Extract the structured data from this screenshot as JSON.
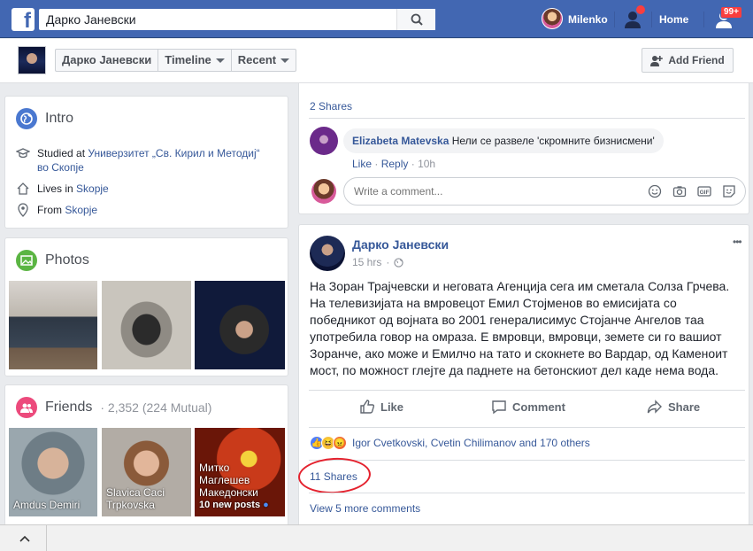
{
  "topbar": {
    "search_value": "Дарко Јаневски",
    "user_name": "Milenko",
    "home_label": "Home",
    "notifications_badge": "99+",
    "brand_color": "#4267b2"
  },
  "subbar": {
    "tabs": [
      "Дарко Јаневски",
      "Timeline",
      "Recent"
    ],
    "add_friend_label": "Add Friend"
  },
  "intro": {
    "title": "Intro",
    "studied_prefix": "Studied at",
    "studied_link": "Универзитет „Св. Кирил и Методиј“",
    "studied_link_2": "во Скопје",
    "lives_prefix": "Lives in",
    "lives_link": "Skopje",
    "from_prefix": "From",
    "from_link": "Skopje"
  },
  "photos": {
    "title": "Photos"
  },
  "friends": {
    "title": "Friends",
    "count": "· 2,352 (224 Mutual)",
    "tiles": [
      {
        "name": "Amdus Demiri",
        "sub": ""
      },
      {
        "name": "Slavica Caci",
        "sub": "Trpkovska"
      },
      {
        "name": "Митко",
        "sub": "Маглешев",
        "sub2": "Македонски",
        "extra": "10 new posts"
      }
    ]
  },
  "prev_post": {
    "shares": "2 Shares",
    "comment_author": "Elizabeta Matevska",
    "comment_text": "Нели се развеле 'скромните бизнисмени'",
    "like": "Like",
    "reply": "Reply",
    "time": "10h",
    "write_placeholder": "Write a comment..."
  },
  "post": {
    "author": "Дарко Јаневски",
    "time": "15 hrs",
    "body": "На Зоран Трајчевски и неговата Агенција сега им сметала Солза Грчева. На телевизијата на вмровецот Емил Стојменов во емисијата со победникот од војната во 2001 генералисимус Стојанче Ангелов таа употребила говор на омраза. Е вмровци, вмровци, земете си го вашиот Зоранче, ако може и Емилчо на тато и скокнете во Вардар, од Каменоит мост, по можност глејте да паднете на бетонскиот дел каде нема вода.",
    "like_label": "Like",
    "comment_label": "Comment",
    "share_label": "Share",
    "reactions_text": "Igor Cvetkovski, Cvetin Chilimanov and 170 others",
    "shares": "11 Shares",
    "view_more": "View 5 more comments",
    "more_icon": "•••"
  }
}
